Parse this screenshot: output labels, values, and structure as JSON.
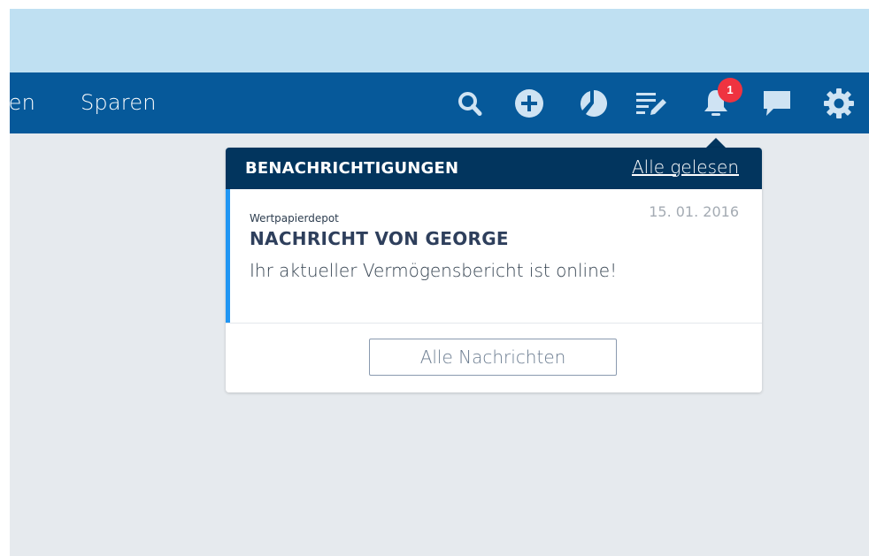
{
  "nav": {
    "items": [
      {
        "label": "ten"
      },
      {
        "label": "Sparen"
      }
    ],
    "icons": [
      {
        "name": "search-icon"
      },
      {
        "name": "add-icon"
      },
      {
        "name": "pie-chart-icon"
      },
      {
        "name": "orders-edit-icon"
      },
      {
        "name": "bell-icon"
      },
      {
        "name": "chat-icon"
      },
      {
        "name": "gear-icon"
      }
    ],
    "notification_count": "1"
  },
  "notifications": {
    "title": "BENACHRICHTIGUNGEN",
    "mark_all_read": "Alle gelesen",
    "items": [
      {
        "category": "Wertpapierdepot",
        "date": "15. 01. 2016",
        "title": "NACHRICHT VON GEORGE",
        "body": "Ihr aktueller Vermögensbericht ist online!"
      }
    ],
    "all_messages_button": "Alle Nachrichten"
  },
  "colors": {
    "top_band": "#bfe0f2",
    "navbar": "#06599a",
    "panel_header": "#02355e",
    "unread_accent": "#2196f3",
    "badge": "#ef3340",
    "background": "#e6eaee"
  }
}
